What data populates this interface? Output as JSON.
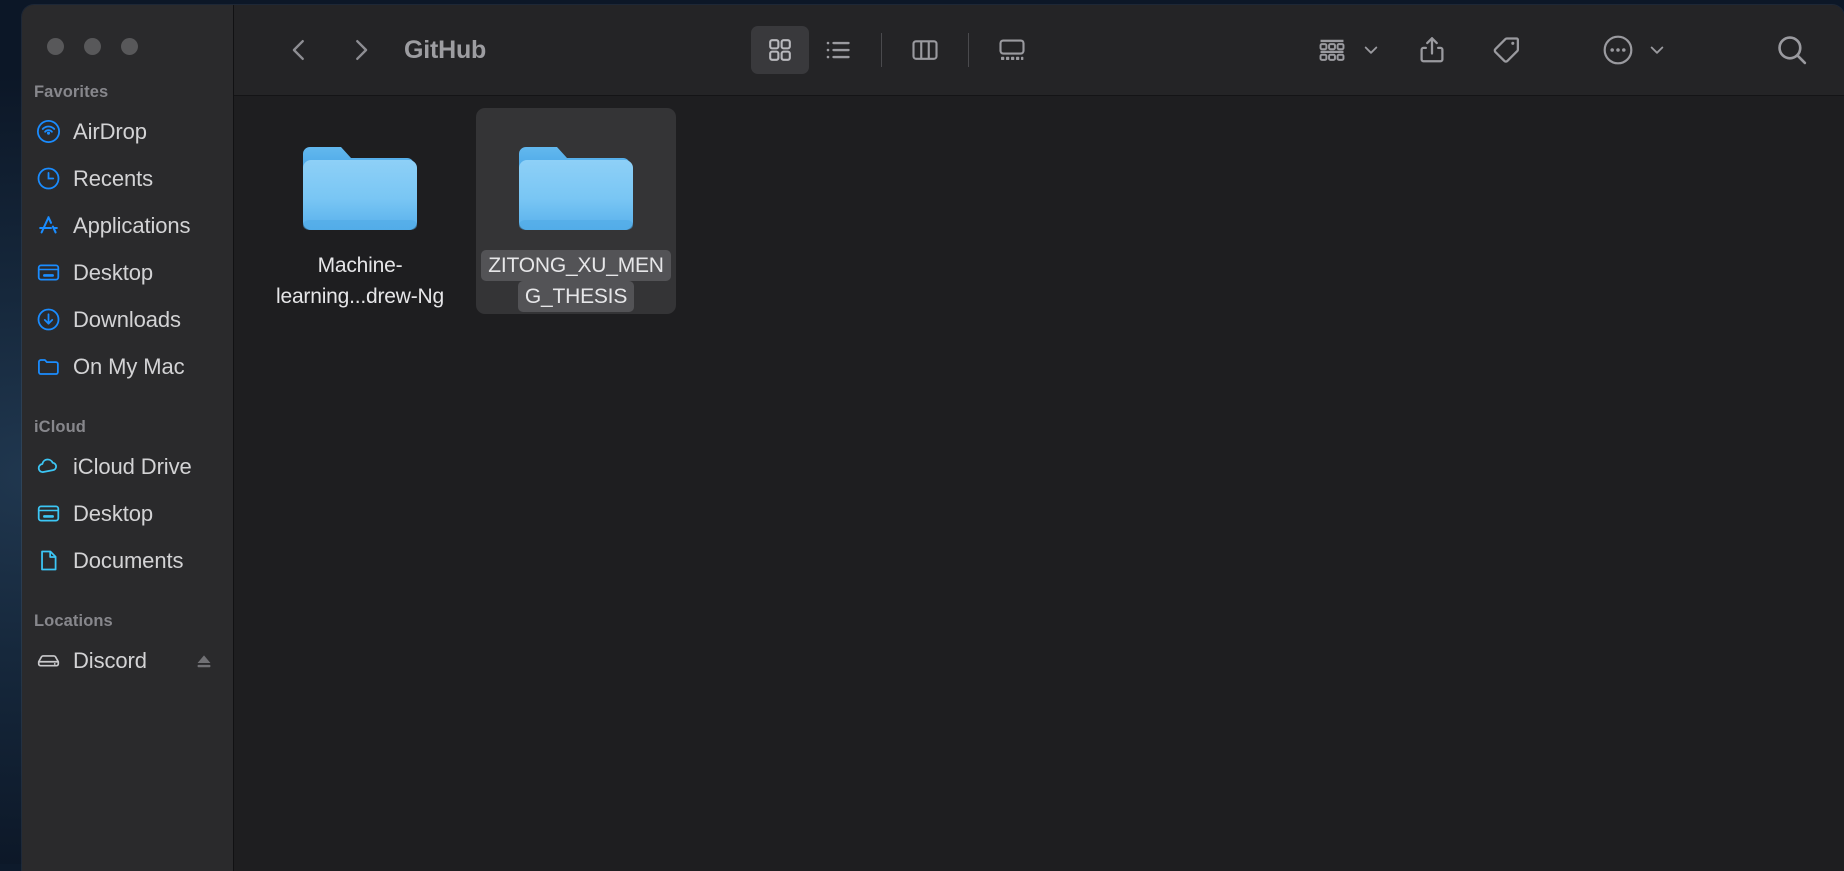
{
  "window": {
    "title": "GitHub",
    "traffic_lights": [
      "close-button",
      "minimize-button",
      "zoom-button"
    ],
    "accent_color": "#0a84ff",
    "sidebar_bg": "#2a2a2c",
    "content_bg": "#1e1e20",
    "toolbar_bg": "#242426"
  },
  "toolbar": {
    "back_label": "Back",
    "forward_label": "Forward",
    "path_title": "GitHub",
    "view_modes": [
      {
        "name": "icon-view",
        "label": "as Icons",
        "active": true
      },
      {
        "name": "list-view",
        "label": "as List",
        "active": false
      },
      {
        "name": "column-view",
        "label": "as Columns",
        "active": false
      },
      {
        "name": "gallery-view",
        "label": "as Gallery",
        "active": false
      }
    ],
    "actions": [
      {
        "name": "group-by-button",
        "label": "Group"
      },
      {
        "name": "share-button",
        "label": "Share"
      },
      {
        "name": "tag-button",
        "label": "Tags"
      },
      {
        "name": "more-actions-button",
        "label": "More"
      },
      {
        "name": "search-button",
        "label": "Search"
      }
    ]
  },
  "sidebar": {
    "groups": [
      {
        "title": "Favorites",
        "items": [
          {
            "label": "AirDrop",
            "icon": "airdrop-icon"
          },
          {
            "label": "Recents",
            "icon": "clock-icon"
          },
          {
            "label": "Applications",
            "icon": "applications-icon"
          },
          {
            "label": "Desktop",
            "icon": "desktop-icon"
          },
          {
            "label": "Downloads",
            "icon": "downloads-icon"
          },
          {
            "label": "On My Mac",
            "icon": "folder-icon"
          }
        ]
      },
      {
        "title": "iCloud",
        "items": [
          {
            "label": "iCloud Drive",
            "icon": "cloud-icon"
          },
          {
            "label": "Desktop",
            "icon": "desktop-icon"
          },
          {
            "label": "Documents",
            "icon": "document-icon"
          }
        ]
      },
      {
        "title": "Locations",
        "items": [
          {
            "label": "Discord",
            "icon": "disk-icon",
            "eject": true
          }
        ]
      }
    ]
  },
  "content": {
    "items": [
      {
        "name": "Machine-learning...drew-Ng",
        "name_lines": [
          "Machine-",
          "learning...drew-Ng"
        ],
        "type": "folder",
        "selected": false
      },
      {
        "name": "ZITONG_XU_MENG_THESIS",
        "name_lines": [
          "ZITONG_XU_MEN",
          "G_THESIS"
        ],
        "type": "folder",
        "selected": true
      }
    ]
  }
}
